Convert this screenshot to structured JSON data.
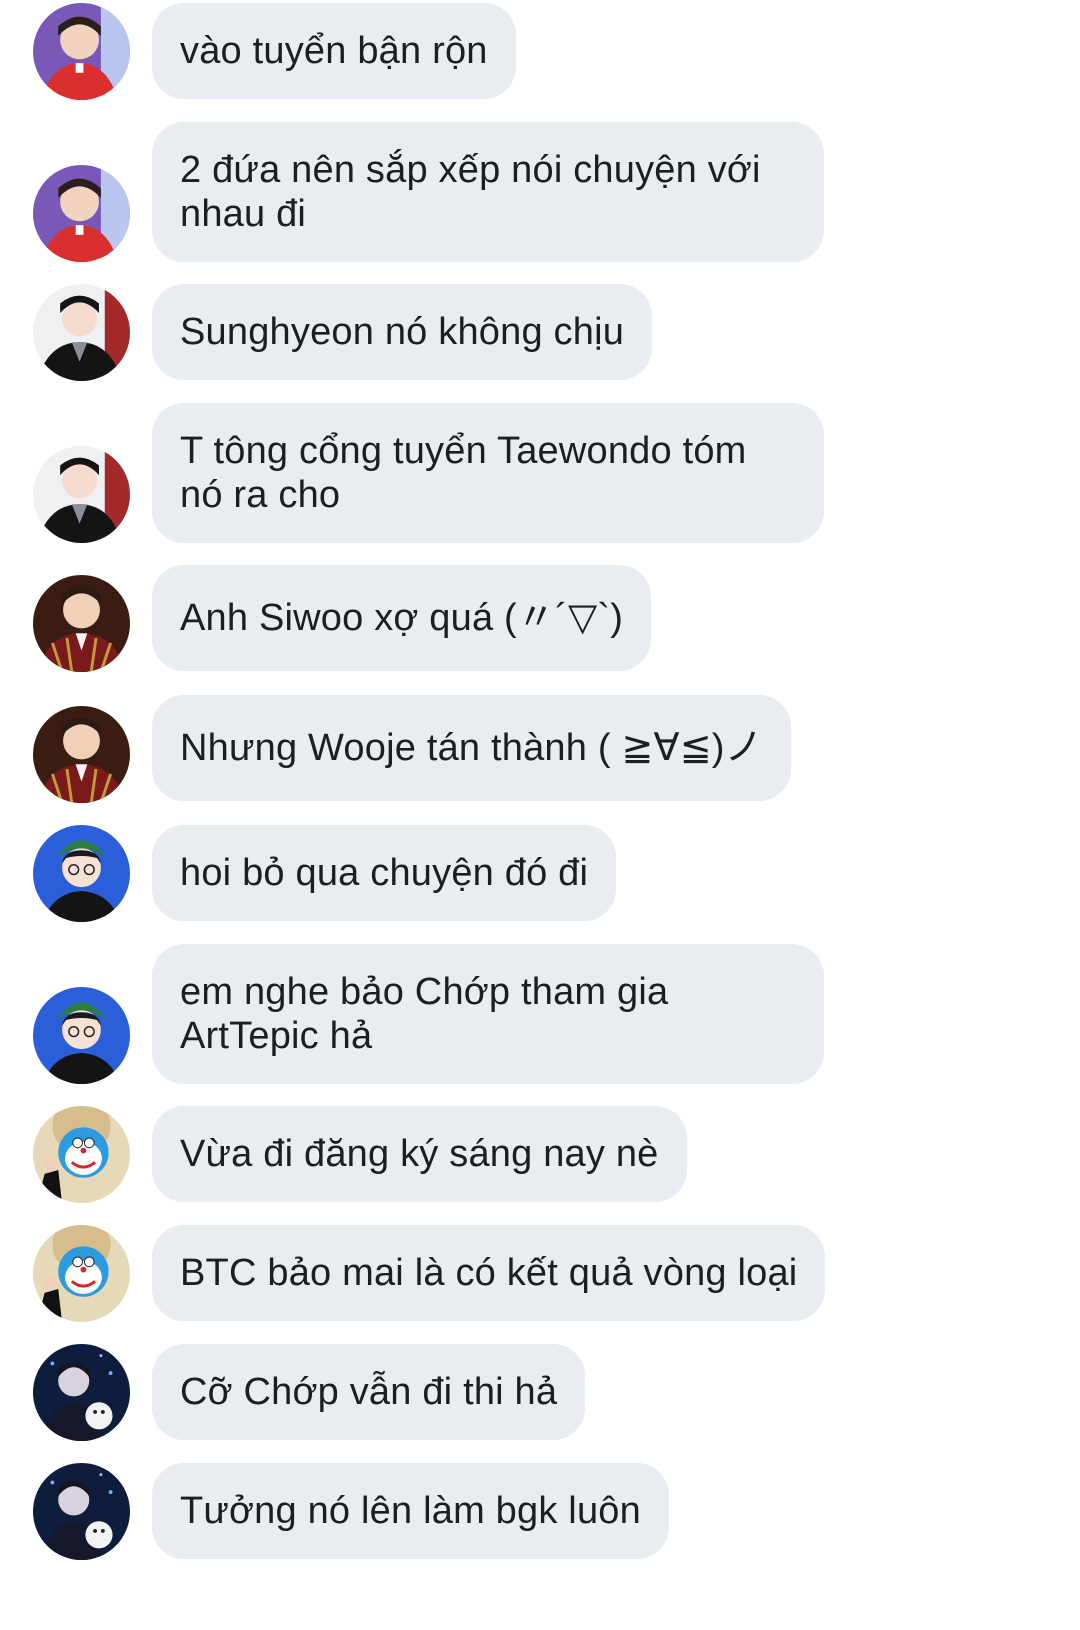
{
  "messages": [
    {
      "avatar": "avatar-player-red-jersey",
      "text": "vào tuyển bận rộn"
    },
    {
      "avatar": "avatar-player-red-jersey",
      "text": "2 đứa nên sắp xếp nói chuyện với nhau đi"
    },
    {
      "avatar": "avatar-player-black-suit",
      "text": "Sunghyeon nó không chịu"
    },
    {
      "avatar": "avatar-player-black-suit",
      "text": "T tông cổng tuyển Taewondo tóm nó ra cho"
    },
    {
      "avatar": "avatar-player-plaid-jacket",
      "text": "Anh Siwoo xợ quá (〃´▽`)"
    },
    {
      "avatar": "avatar-player-plaid-jacket",
      "text": "Nhưng Wooje tán thành ( ≧∀≦)ノ"
    },
    {
      "avatar": "avatar-player-green-hat",
      "text": "hoi bỏ qua chuyện đó đi"
    },
    {
      "avatar": "avatar-player-green-hat",
      "text": "em nghe bảo Chớp tham gia ArtTepic hả"
    },
    {
      "avatar": "avatar-doraemon",
      "text": "Vừa đi đăng ký sáng nay nè"
    },
    {
      "avatar": "avatar-doraemon",
      "text": "BTC bảo mai là có kết quả vòng loại"
    },
    {
      "avatar": "avatar-player-dark-blue",
      "text": "Cỡ Chớp vẫn đi thi hả"
    },
    {
      "avatar": "avatar-player-dark-blue",
      "text": "Tưởng nó lên làm bgk luôn"
    }
  ]
}
